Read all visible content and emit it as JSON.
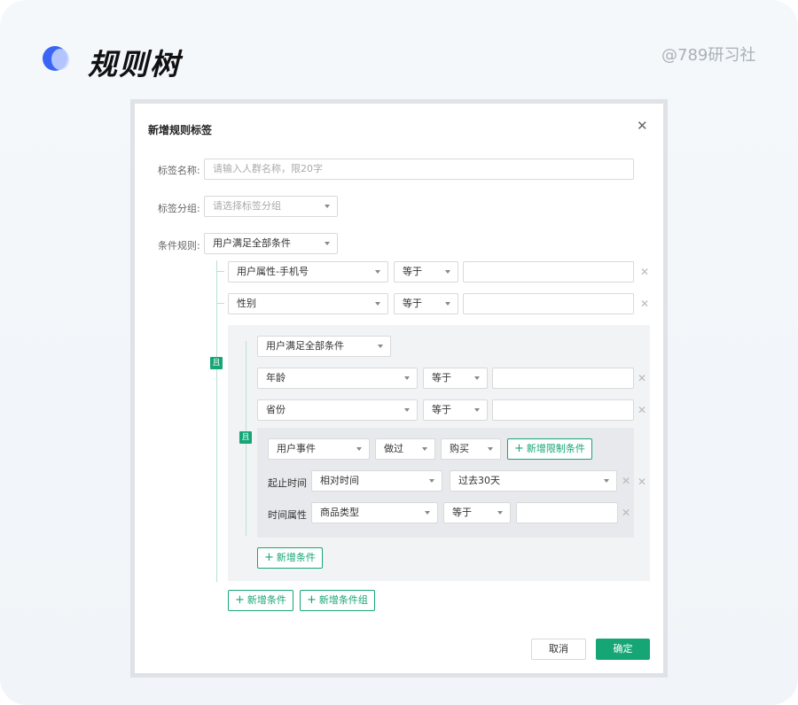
{
  "header": {
    "title": "规则树",
    "watermark": "@789研习社"
  },
  "dialog": {
    "title": "新增规则标签",
    "form": {
      "name_label": "标签名称:",
      "name_placeholder": "请输入人群名称，限20字",
      "group_label": "标签分组:",
      "group_placeholder": "请选择标签分组",
      "rule_label": "条件规则:",
      "rule_value": "用户满足全部条件"
    },
    "connector": "且",
    "conditions": [
      {
        "field": "用户属性-手机号",
        "op": "等于",
        "value": ""
      },
      {
        "field": "性别",
        "op": "等于",
        "value": ""
      }
    ],
    "subgroup": {
      "rule_value": "用户满足全部条件",
      "connector": "且",
      "conditions": [
        {
          "field": "年龄",
          "op": "等于",
          "value": ""
        },
        {
          "field": "省份",
          "op": "等于",
          "value": ""
        }
      ],
      "event": {
        "type": "用户事件",
        "action": "做过",
        "event_name": "购买",
        "add_limit": "新增限制条件",
        "time_label": "起止时间",
        "time_mode": "相对时间",
        "time_range": "过去30天",
        "attr_label": "时间属性",
        "attr_field": "商品类型",
        "attr_op": "等于",
        "attr_value": ""
      },
      "add_condition": "新增条件"
    },
    "add_condition": "新增条件",
    "add_condition_group": "新增条件组",
    "cancel": "取消",
    "confirm": "确定"
  }
}
